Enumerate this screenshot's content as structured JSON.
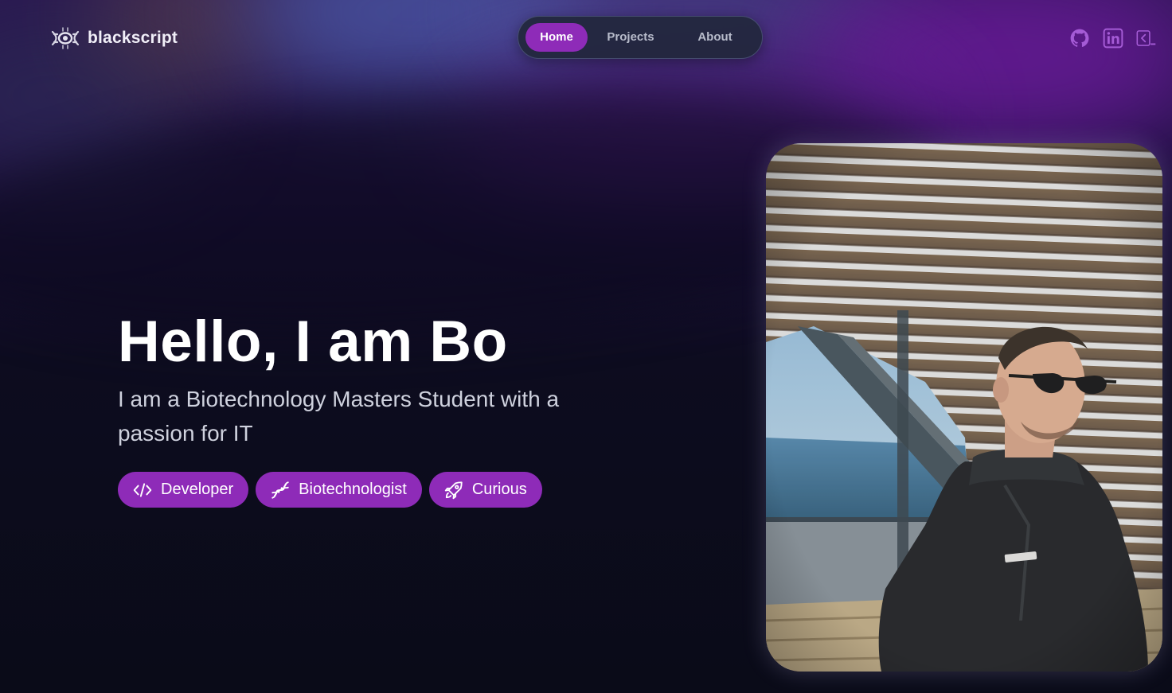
{
  "brand": {
    "name": "blackscript",
    "logo_icon": "eye-dna-logo"
  },
  "nav": {
    "items": [
      {
        "label": "Home",
        "active": true
      },
      {
        "label": "Projects",
        "active": false
      },
      {
        "label": "About",
        "active": false
      }
    ]
  },
  "socials": [
    {
      "icon": "github-icon"
    },
    {
      "icon": "linkedin-icon"
    },
    {
      "icon": "terminal-icon"
    }
  ],
  "hero": {
    "title": "Hello, I am Bo",
    "subtitle": "I am a Biotechnology Masters Student with a passion for IT",
    "tags": [
      {
        "label": "Developer",
        "icon": "code-icon"
      },
      {
        "label": "Biotechnologist",
        "icon": "dna-icon"
      },
      {
        "label": "Curious",
        "icon": "rocket-icon"
      }
    ]
  },
  "photo": {
    "subject": "man in sunglasses and dark jacket in front of wooden slatted structure by the sea"
  },
  "colors": {
    "accent": "#8e2bb8",
    "background": "#0a0b18",
    "nav_pill": "#22273c",
    "text_muted": "#cfd2de",
    "icon": "#a55bd6"
  }
}
